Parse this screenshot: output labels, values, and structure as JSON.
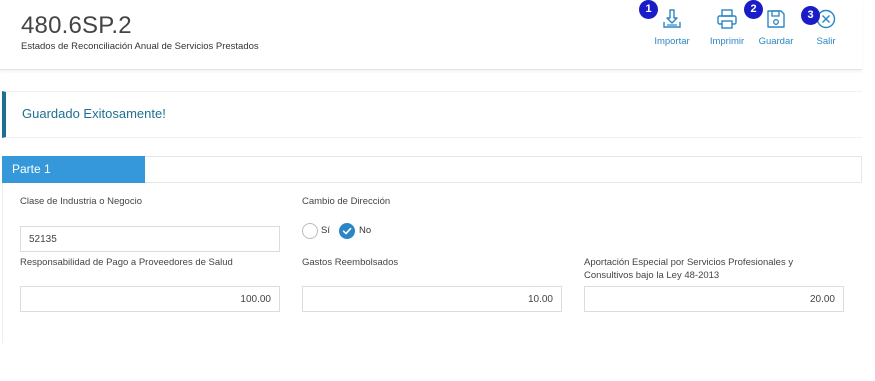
{
  "header": {
    "form_code": "480.6SP.2",
    "form_description": "Estados de Reconciliación Anual de Servicios Prestados"
  },
  "toolbar": {
    "import_label": "Importar",
    "print_label": "Imprimir",
    "save_label": "Guardar",
    "exit_label": "Salir",
    "accent_color": "#2a86c4"
  },
  "badges": [
    "1",
    "2",
    "3"
  ],
  "alert": {
    "message": "Guardado Exitosamente!",
    "color": "#1f6f92"
  },
  "section": {
    "tab_label": "Parte 1",
    "tab_color": "#3498db"
  },
  "fields": {
    "industry_label": "Clase de Industria o Negocio",
    "industry_value": "52135",
    "address_change_label": "Cambio de Dirección",
    "address_change_options": [
      "Sí",
      "No"
    ],
    "address_change_selected": "No",
    "health_label": "Responsabilidad de Pago a Proveedores de Salud",
    "health_value": "100.00",
    "reimbursed_label": "Gastos Reembolsados",
    "reimbursed_value": "10.00",
    "special_label_line1": "Aportación Especial por Servicios Profesionales y",
    "special_label_line2": "Consultivos bajo la Ley 48-2013",
    "special_value": "20.00"
  }
}
